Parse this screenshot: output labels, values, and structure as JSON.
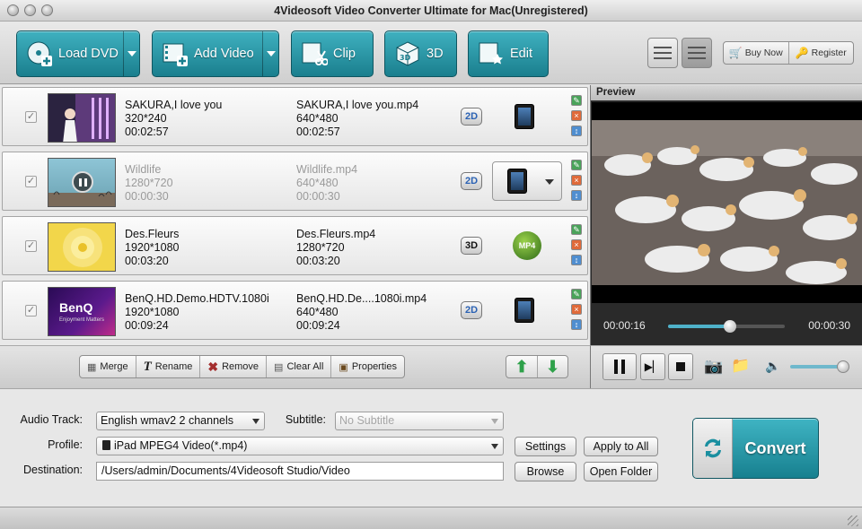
{
  "window": {
    "title": "4Videosoft Video Converter Ultimate for Mac(Unregistered)"
  },
  "toolbar": {
    "load_dvd": "Load DVD",
    "add_video": "Add Video",
    "clip": "Clip",
    "three_d": "3D",
    "edit": "Edit",
    "buy_now": "Buy Now",
    "register": "Register"
  },
  "files": [
    {
      "name": "SAKURA,I love you",
      "resolution": "320*240",
      "duration": "00:02:57",
      "out_name": "SAKURA,I love you.mp4",
      "out_resolution": "640*480",
      "out_duration": "00:02:57",
      "mode": "2D",
      "device": "ipad-icon"
    },
    {
      "name": "Wildlife",
      "resolution": "1280*720",
      "duration": "00:00:30",
      "out_name": "Wildlife.mp4",
      "out_resolution": "640*480",
      "out_duration": "00:00:30",
      "mode": "2D",
      "device": "ipad-icon"
    },
    {
      "name": "Des.Fleurs",
      "resolution": "1920*1080",
      "duration": "00:03:20",
      "out_name": "Des.Fleurs.mp4",
      "out_resolution": "1280*720",
      "out_duration": "00:03:20",
      "mode": "3D",
      "device": "mp4-3d-icon",
      "device_text": "MP4"
    },
    {
      "name": "BenQ.HD.Demo.HDTV.1080i",
      "resolution": "1920*1080",
      "duration": "00:09:24",
      "out_name": "BenQ.HD.De....1080i.mp4",
      "out_resolution": "640*480",
      "out_duration": "00:09:24",
      "mode": "2D",
      "device": "ipad-icon"
    }
  ],
  "thumbs": {
    "benq_logo": "BenQ",
    "benq_sub": "Enjoyment Matters"
  },
  "listbar": {
    "merge": "Merge",
    "rename": "Rename",
    "remove": "Remove",
    "clear_all": "Clear All",
    "properties": "Properties"
  },
  "preview": {
    "label": "Preview",
    "current_time": "00:00:16",
    "duration": "00:00:30",
    "progress": 0.533,
    "volume": 0.95
  },
  "settings": {
    "audio_track_label": "Audio Track:",
    "audio_track_value": "English wmav2 2 channels",
    "subtitle_label": "Subtitle:",
    "subtitle_value": "No Subtitle",
    "profile_label": "Profile:",
    "profile_value": "iPad MPEG4 Video(*.mp4)",
    "destination_label": "Destination:",
    "destination_value": "/Users/admin/Documents/4Videosoft Studio/Video",
    "settings_btn": "Settings",
    "apply_all_btn": "Apply to All",
    "browse_btn": "Browse",
    "open_folder_btn": "Open Folder",
    "convert_btn": "Convert"
  },
  "colors": {
    "accent": "#1f8fa0",
    "green_arrow": "#2ea14a"
  }
}
